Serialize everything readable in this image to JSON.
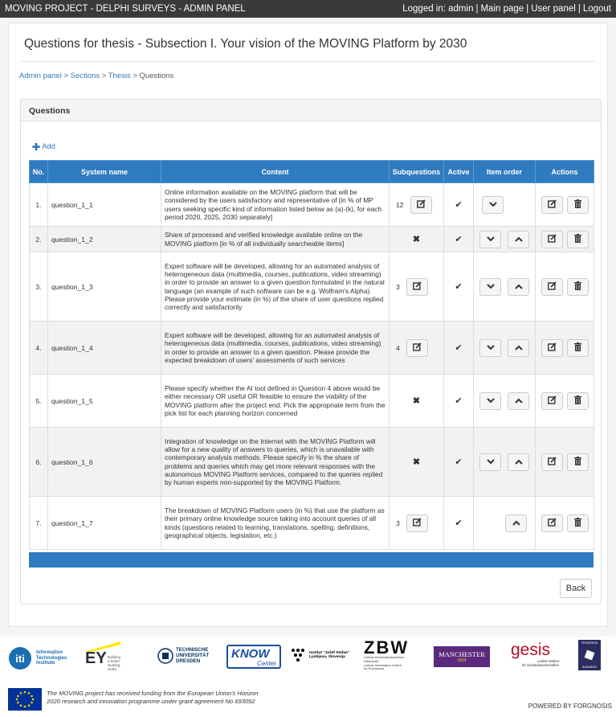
{
  "topbar": {
    "title": "MOVING PROJECT - DELPHI SURVEYS - ADMIN PANEL",
    "logged_in": "Logged in: admin",
    "main_page": "Main page",
    "user_panel": "User panel",
    "logout": "Logout",
    "separator": "|"
  },
  "page": {
    "title": "Questions for thesis - Subsection I. Your vision of the MOVING Platform by 2030",
    "breadcrumb": [
      "Admin panel",
      "Sections",
      "Thesis",
      "Questions"
    ],
    "breadcrumb_sep": " > "
  },
  "panel": {
    "heading": "Questions",
    "add_label": "Add",
    "back_label": "Back"
  },
  "table": {
    "headers": [
      "No.",
      "System name",
      "Content",
      "Subquestions",
      "Active",
      "Item order",
      "Actions"
    ],
    "rows": [
      {
        "no": "1.",
        "system_name": "question_1_1",
        "content": "Online information available on the MOVING platform that will be considered by the users satisfactory and representative of [in % of MP users seeking specific kind of information listed below as (a)-(k), for each period 2020, 2025, 2030 separately]",
        "subquestions": "12",
        "active": true,
        "order_down": true,
        "order_up": false
      },
      {
        "no": "2.",
        "system_name": "question_1_2",
        "content": "Share of processed and verified knowledge available online on the MOVING platform [in % of all individually searcheable items]",
        "subquestions": "",
        "active": true,
        "order_down": true,
        "order_up": true
      },
      {
        "no": "3.",
        "system_name": "question_1_3",
        "content": "Expert software will be developed, allowing for an automated analysis of heterogeneous data (multimedia, courses, publications, video streaming) in order to provide an answer to a given question formulated in the natural language (an example of such software can be e.g. Wolfram's Alpha). Please provide your estimate (in %) of the share of user questions replied correctly and satisfactorily",
        "subquestions": "3",
        "active": true,
        "order_down": true,
        "order_up": true
      },
      {
        "no": "4.",
        "system_name": "question_1_4",
        "content": "Expert software will be developed, allowing for an automated analysis of heterogeneous data (multimedia, courses, publications, video streaming) in order to provide an answer to a given question. Please provide the expected breakdown of users' assessments of such services",
        "subquestions": "4",
        "active": true,
        "order_down": true,
        "order_up": true
      },
      {
        "no": "5.",
        "system_name": "question_1_5",
        "content": "Please specify whether the AI tool defined in Question 4 above would be either necessary OR useful OR feasible to ensure the viability of the MOVING platform after the project end. Pick the appropriate term from the pick list for each planning horizon concerned",
        "subquestions": "",
        "active": true,
        "order_down": true,
        "order_up": true
      },
      {
        "no": "6.",
        "system_name": "question_1_6",
        "content": "Integration of knowledge on the Internet with the MOVING Platform will allow for a new quality of answers to queries, which is unavailable with contemporary analysis methods. Please specify in % the share of problems and queries which may get more relevant responses with the autonomous MOVING Platform services, compared to the queries replied by human experts non-supported by the MOVING Platform.",
        "subquestions": "",
        "active": true,
        "order_down": true,
        "order_up": true
      },
      {
        "no": "7.",
        "system_name": "question_1_7",
        "content": "The breakdown of MOVING Platform users (in %) that use the platform as their primary online knowledge source taking into account queries of all kinds (questions related to learning, translations, spelling, definitions, geographical objects, legislation, etc.)",
        "subquestions": "3",
        "active": true,
        "order_down": false,
        "order_up": true
      }
    ]
  },
  "footer": {
    "logos": {
      "iti_line1": "Information",
      "iti_line2": "Technologies",
      "iti_line3": "Institute",
      "ey_mark": "EY",
      "ey_tag_line1": "Building a better",
      "ey_tag_line2": "working world",
      "tud_line1": "TECHNISCHE",
      "tud_line2": "UNIVERSITÄT",
      "tud_line3": "DRESDEN",
      "know_line1": "KNOW",
      "know_line2": "Center",
      "ijs_line1": "Institut \"Jožef Stefan\"",
      "ijs_line2": "Ljubljana, Slovenija",
      "zbw_mark": "ZBW",
      "zbw_line1": "Leibniz-Informationszentrum",
      "zbw_line2": "Wirtschaft",
      "zbw_line3": "Leibniz Information Centre",
      "zbw_line4": "for Economics",
      "manchester": "MANCHESTER",
      "manchester_year": "1824",
      "gesis_mark": "gesis",
      "gesis_line1": "Leibniz-Institut",
      "gesis_line2": "für Sozialwissenschaften",
      "pb_line1": "PROGRESS",
      "pb_line2": "BUSINESS"
    },
    "funding_line1": "The MOVING project has received funding from the European Union's Horizon",
    "funding_line2": "2020 research and innovation programme under grant agreement No 693092",
    "powered_by": "POWERED BY FORGNOSIS"
  },
  "colors": {
    "table_header": "#2f7bbf",
    "topbar": "#3a3a3a",
    "link": "#337ab7"
  }
}
